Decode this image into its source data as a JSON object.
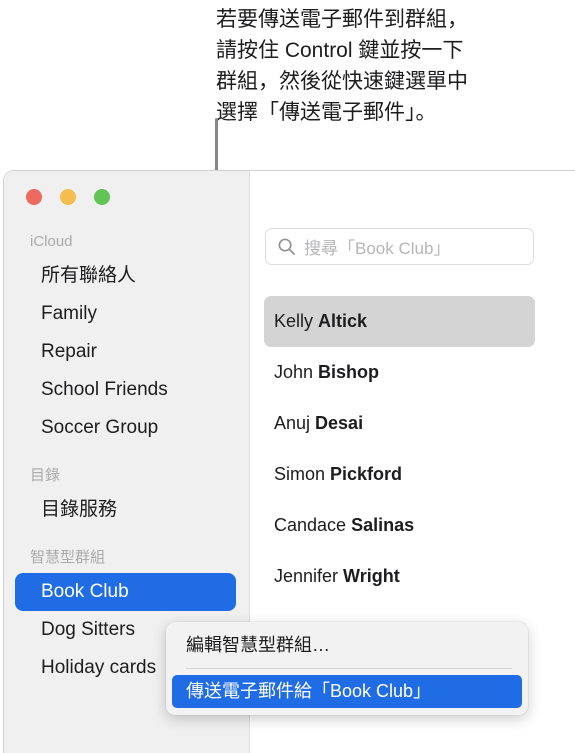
{
  "callout": {
    "text": "若要傳送電子郵件到群組，\n請按住 Control 鍵並按一下\n群組，然後從快速鍵選單中\n選擇「傳送電子郵件」。"
  },
  "window": {
    "traffic_lights": [
      {
        "name": "close",
        "color": "#ec6a5e"
      },
      {
        "name": "minimize",
        "color": "#f5bd4f"
      },
      {
        "name": "maximize",
        "color": "#61c454"
      }
    ]
  },
  "sidebar": {
    "sections": [
      {
        "header": "iCloud",
        "items": [
          {
            "label": "所有聯絡人",
            "selected": false
          },
          {
            "label": "Family",
            "selected": false
          },
          {
            "label": "Repair",
            "selected": false
          },
          {
            "label": "School Friends",
            "selected": false
          },
          {
            "label": "Soccer Group",
            "selected": false
          }
        ]
      },
      {
        "header": "目錄",
        "items": [
          {
            "label": "目錄服務",
            "selected": false
          }
        ]
      },
      {
        "header": "智慧型群組",
        "items": [
          {
            "label": "Book Club",
            "selected": true
          },
          {
            "label": "Dog Sitters",
            "selected": false
          },
          {
            "label": "Holiday cards",
            "selected": false
          }
        ]
      }
    ],
    "selection_color": "#1f6ce5"
  },
  "search": {
    "icon": "search-icon",
    "placeholder": "搜尋「Book Club」",
    "value": ""
  },
  "contacts": {
    "rows": [
      {
        "first": "Kelly ",
        "last": "Altick",
        "selected": true
      },
      {
        "first": "John ",
        "last": "Bishop",
        "selected": false
      },
      {
        "first": "Anuj ",
        "last": "Desai",
        "selected": false
      },
      {
        "first": "Simon ",
        "last": "Pickford",
        "selected": false
      },
      {
        "first": "Candace ",
        "last": "Salinas",
        "selected": false
      },
      {
        "first": "Jennifer ",
        "last": "Wright",
        "selected": false
      }
    ],
    "selection_color": "#d4d4d4"
  },
  "context_menu": {
    "items": [
      {
        "label": "編輯智慧型群組…",
        "highlighted": false
      },
      {
        "label": "傳送電子郵件給「Book Club」",
        "highlighted": true
      }
    ],
    "highlight_color": "#1f6ce5"
  }
}
